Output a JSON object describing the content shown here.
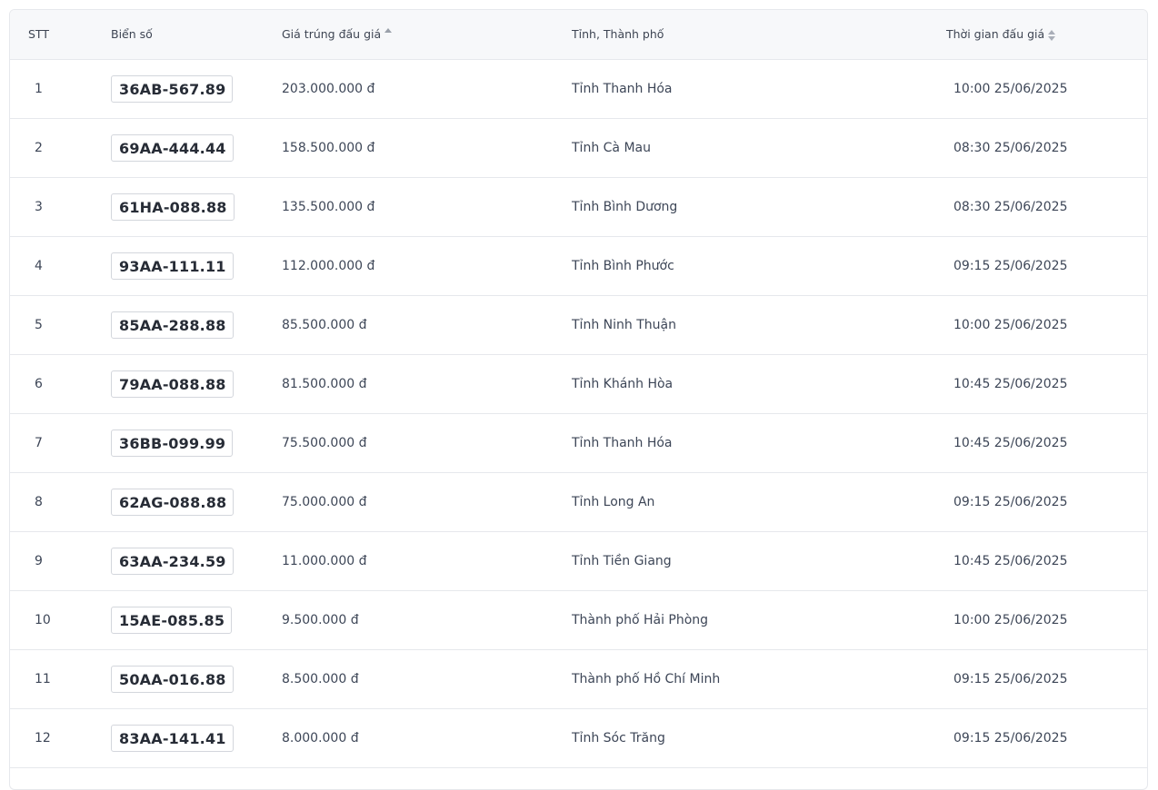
{
  "table": {
    "headers": {
      "stt": "STT",
      "plate": "Biển số",
      "price": "Giá trúng đấu giá",
      "province": "Tỉnh, Thành phố",
      "time": "Thời gian đấu giá"
    },
    "sort": {
      "price": "ascending",
      "time": "unsorted"
    },
    "rows": [
      {
        "stt": "1",
        "plate": "36AB-567.89",
        "price": "203.000.000 đ",
        "province": "Tỉnh Thanh Hóa",
        "time": "10:00 25/06/2025"
      },
      {
        "stt": "2",
        "plate": "69AA-444.44",
        "price": "158.500.000 đ",
        "province": "Tỉnh Cà Mau",
        "time": "08:30 25/06/2025"
      },
      {
        "stt": "3",
        "plate": "61HA-088.88",
        "price": "135.500.000 đ",
        "province": "Tỉnh Bình Dương",
        "time": "08:30 25/06/2025"
      },
      {
        "stt": "4",
        "plate": "93AA-111.11",
        "price": "112.000.000 đ",
        "province": "Tỉnh Bình Phước",
        "time": "09:15 25/06/2025"
      },
      {
        "stt": "5",
        "plate": "85AA-288.88",
        "price": "85.500.000 đ",
        "province": "Tỉnh Ninh Thuận",
        "time": "10:00 25/06/2025"
      },
      {
        "stt": "6",
        "plate": "79AA-088.88",
        "price": "81.500.000 đ",
        "province": "Tỉnh Khánh Hòa",
        "time": "10:45 25/06/2025"
      },
      {
        "stt": "7",
        "plate": "36BB-099.99",
        "price": "75.500.000 đ",
        "province": "Tỉnh Thanh Hóa",
        "time": "10:45 25/06/2025"
      },
      {
        "stt": "8",
        "plate": "62AG-088.88",
        "price": "75.000.000 đ",
        "province": "Tỉnh Long An",
        "time": "09:15 25/06/2025"
      },
      {
        "stt": "9",
        "plate": "63AA-234.59",
        "price": "11.000.000 đ",
        "province": "Tỉnh Tiền Giang",
        "time": "10:45 25/06/2025"
      },
      {
        "stt": "10",
        "plate": "15AE-085.85",
        "price": "9.500.000 đ",
        "province": "Thành phố Hải Phòng",
        "time": "10:00 25/06/2025"
      },
      {
        "stt": "11",
        "plate": "50AA-016.88",
        "price": "8.500.000 đ",
        "province": "Thành phố Hồ Chí Minh",
        "time": "09:15 25/06/2025"
      },
      {
        "stt": "12",
        "plate": "83AA-141.41",
        "price": "8.000.000 đ",
        "province": "Tỉnh Sóc Trăng",
        "time": "09:15 25/06/2025"
      }
    ]
  }
}
